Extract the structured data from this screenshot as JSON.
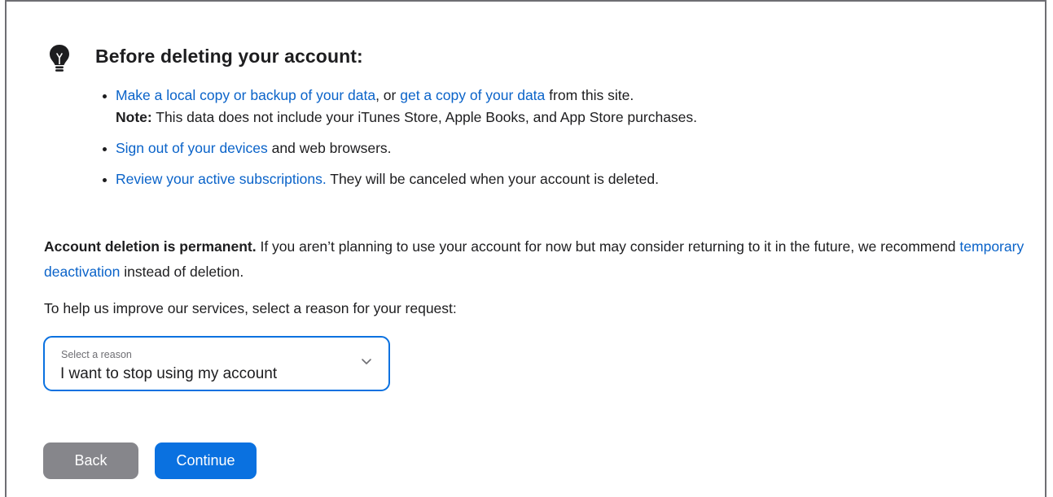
{
  "heading": "Before deleting your account:",
  "tips": {
    "item1": {
      "link1": "Make a local copy or backup of your data",
      "sep": ", or ",
      "link2": "get a copy of your data",
      "tail": " from this site.",
      "note_label": "Note:",
      "note_text": " This data does not include your iTunes Store, Apple Books, and App Store purchases."
    },
    "item2": {
      "link": "Sign out of your devices",
      "tail": " and web browsers."
    },
    "item3": {
      "link": "Review your active subscriptions.",
      "tail": " They will be canceled when your account is deleted."
    }
  },
  "permanent": {
    "bold": "Account deletion is permanent.",
    "text": " If you aren’t planning to use your account for now but may consider returning to it in the future, we recommend ",
    "link": "temporary deactivation",
    "tail": " instead of deletion."
  },
  "reason_prompt": "To help us improve our services, select a reason for your request:",
  "reason_select": {
    "label": "Select a reason",
    "value": "I want to stop using my account"
  },
  "buttons": {
    "back": "Back",
    "continue": "Continue"
  },
  "colors": {
    "link": "#0a63c9",
    "accent": "#0a71e0",
    "back_button": "#86868b"
  },
  "icons": {
    "tip": "lightbulb-icon",
    "select": "chevron-down-icon"
  }
}
